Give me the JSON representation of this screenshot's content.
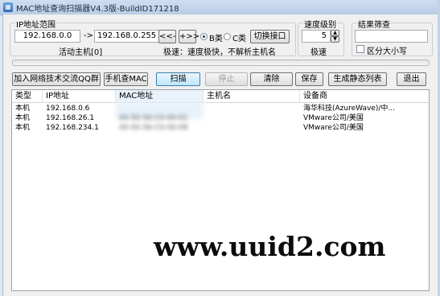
{
  "window": {
    "title": "MAC地址查询扫描器V4.3版-BuildID171218",
    "icon": "app-icon"
  },
  "ip_range": {
    "group_title": "IP地址范围",
    "start_ip": "192.168.0.0",
    "arrow": "->",
    "end_ip": "192.168.0.255",
    "prev_button": "<<-",
    "next_button": "+>>",
    "class_b_label": "B类",
    "class_c_label": "C类",
    "selected_class": "B类",
    "switch_interface_button": "切换接口",
    "active_hosts": "活动主机[0]",
    "speed_note": "极速：速度极快，不解析主机名"
  },
  "speed": {
    "title": "速度级别",
    "value": "5",
    "label": "极速",
    "up_icon": "spin-up-icon",
    "down_icon": "spin-down-icon"
  },
  "filter": {
    "title": "结果筛查",
    "value": "",
    "case_label": "区分大小写",
    "case_checked": false
  },
  "progress": {
    "fraction": 0.0
  },
  "toolbar": {
    "join_group": "加入网络技术交流QQ群",
    "phone_mac": "手机查MAC",
    "scan": "扫描",
    "stop": "停止",
    "clear": "清除",
    "save": "保存",
    "static_list": "生成静态列表",
    "exit": "退出"
  },
  "table": {
    "columns": [
      "类型",
      "IP地址",
      "MAC地址",
      "主机名",
      "设备商"
    ],
    "rows": [
      {
        "type": "本机",
        "ip": "192.168.0.6",
        "mac": "",
        "host": "",
        "vendor": "海华科技(AzureWave)/中..."
      },
      {
        "type": "本机",
        "ip": "192.168.26.1",
        "mac": "00-50-56-C0-00-01",
        "host": "",
        "vendor": "VMware公司/美国"
      },
      {
        "type": "本机",
        "ip": "192.168.234.1",
        "mac": "00-50-56-C0-00-08",
        "host": "",
        "vendor": "VMware公司/美国"
      }
    ]
  },
  "watermark": "www.uuid2.com",
  "colors": {
    "title_bar": "#b8cde6",
    "frame": "#dfe8f3",
    "scan_button": "#bee6fd",
    "progress": "#4fbf4f"
  }
}
